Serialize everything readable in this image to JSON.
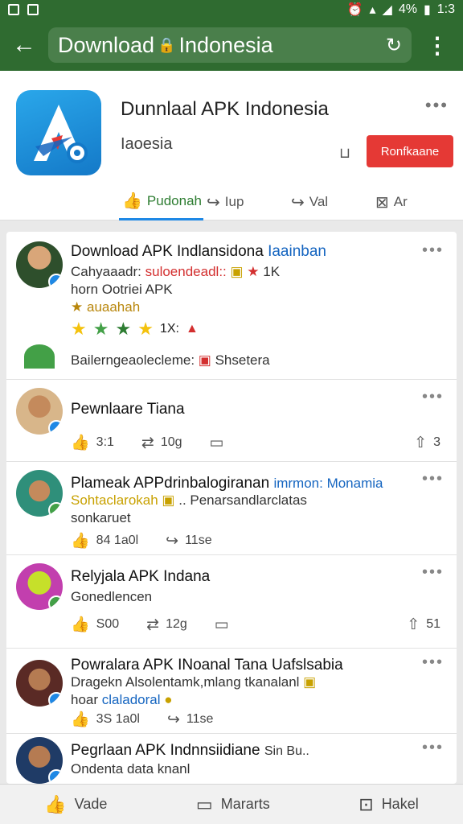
{
  "status": {
    "battery": "4%",
    "time": "1:3"
  },
  "browser": {
    "url": "Download",
    "url_tail": "Indonesia"
  },
  "app": {
    "title": "Dunnlaal APK Indonesia",
    "subtitle": "Iaoesia",
    "install_label": "Ronfkaane",
    "tabs": [
      {
        "label": "Pudonah",
        "icon": "thumbs-up-icon"
      },
      {
        "label": "Iup",
        "icon": "share-icon"
      },
      {
        "label": "Val",
        "icon": "share-icon"
      },
      {
        "label": "Ar",
        "icon": "bookmark-icon"
      }
    ]
  },
  "posts": [
    {
      "name": "Download APK Indlansidona",
      "tag": "Iaainban",
      "line1_a": "Cahyaaadr:",
      "line1_b": "suloendeadl::",
      "line1_c": "1K",
      "line2": "horn Ootriei APK",
      "line3": "auaahah",
      "rating_text": "1X:",
      "footer": "Bailerngeaolecleme:",
      "footer_b": "Shsetera"
    },
    {
      "name": "Pewnlaare Tiana",
      "likes": "3:1",
      "reposts": "10g",
      "shares": "3"
    },
    {
      "name": "Plameak APPdrinbalogiranan",
      "tag": "imrmon: Monamia",
      "line1_a": "Sohtaclarokah",
      "line1_b": ".. Penarsandlarclatas",
      "line2": "sonkaruet",
      "likes": "84 1a0l",
      "shares": "11se"
    },
    {
      "name": "Relyjala APK Indana",
      "line1": "Gonedlencen",
      "likes": "S00",
      "reposts": "12g",
      "shares": "51"
    },
    {
      "name": "Powralara APK INoanal Tana Uafslsabia",
      "line1": "Dragekn Alsolentamk,mlang tkanalanl",
      "line2_a": "hoar",
      "line2_b": "claladoral",
      "likes": "3S 1a0l",
      "shares": "11se"
    },
    {
      "name": "Pegrlaan APK Indnnsiidiane",
      "tag": "Sin Bu..",
      "line1": "Ondenta data knanl"
    }
  ],
  "bottom_nav": [
    {
      "label": "Vade",
      "icon": "thumbs-up-icon"
    },
    {
      "label": "Mararts",
      "icon": "chat-icon"
    },
    {
      "label": "Hakel",
      "icon": "bookmark-icon"
    }
  ]
}
